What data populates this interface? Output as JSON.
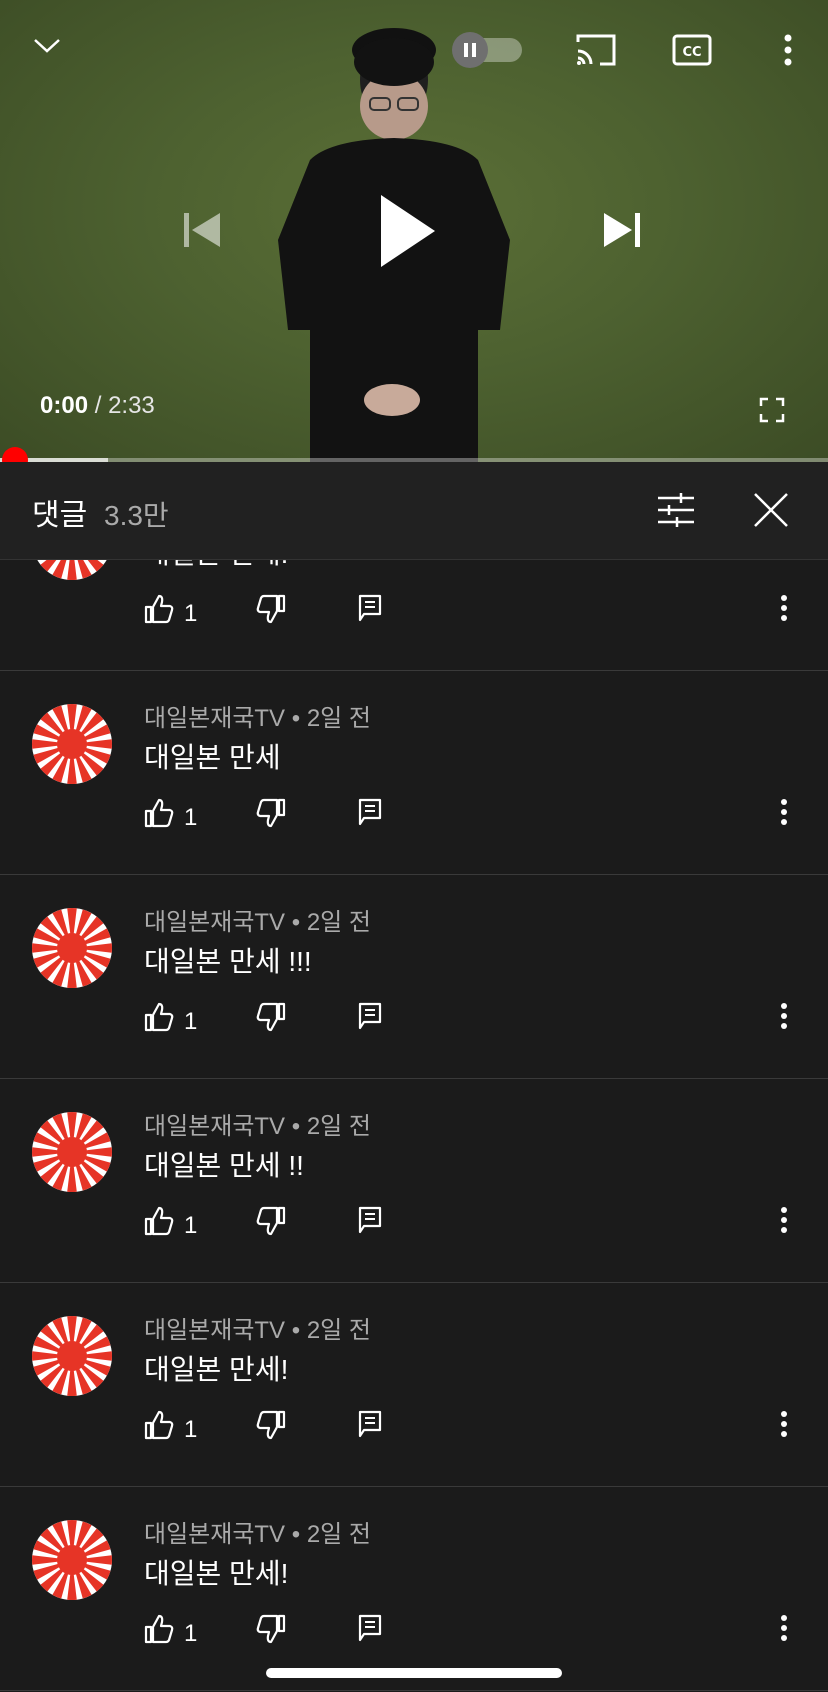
{
  "player": {
    "current_time": "0:00",
    "separator": "/",
    "duration": "2:33",
    "progress_fraction": 0.0,
    "autoplay_on": false
  },
  "comments_header": {
    "title": "댓글",
    "count": "3.3만"
  },
  "comments": [
    {
      "author": "",
      "time": "",
      "text": "대일본 만세!",
      "likes": "1"
    },
    {
      "author": "대일본재국TV",
      "time": "2일 전",
      "text": "대일본 만세",
      "likes": "1"
    },
    {
      "author": "대일본재국TV",
      "time": "2일 전",
      "text": "대일본 만세 !!!",
      "likes": "1"
    },
    {
      "author": "대일본재국TV",
      "time": "2일 전",
      "text": "대일본 만세 !!",
      "likes": "1"
    },
    {
      "author": "대일본재국TV",
      "time": "2일 전",
      "text": "대일본 만세!",
      "likes": "1"
    },
    {
      "author": "대일본재국TV",
      "time": "2일 전",
      "text": "대일본 만세!",
      "likes": "1"
    }
  ],
  "meta_separator": "•",
  "icons": {
    "collapse": "chevron-down-icon",
    "autoplay": "autoplay-toggle",
    "cast": "cast-icon",
    "captions": "cc-icon",
    "more": "more-vert-icon",
    "previous": "skip-previous-icon",
    "play": "play-icon",
    "next": "skip-next-icon",
    "fullscreen": "fullscreen-icon",
    "filter": "tune-icon",
    "close": "close-icon",
    "like": "thumb-up-icon",
    "dislike": "thumb-down-icon",
    "reply": "reply-icon"
  },
  "colors": {
    "progress": "#ff0000",
    "background": "#1b1b1b",
    "header": "#212121",
    "avatar_red": "#e63426"
  }
}
